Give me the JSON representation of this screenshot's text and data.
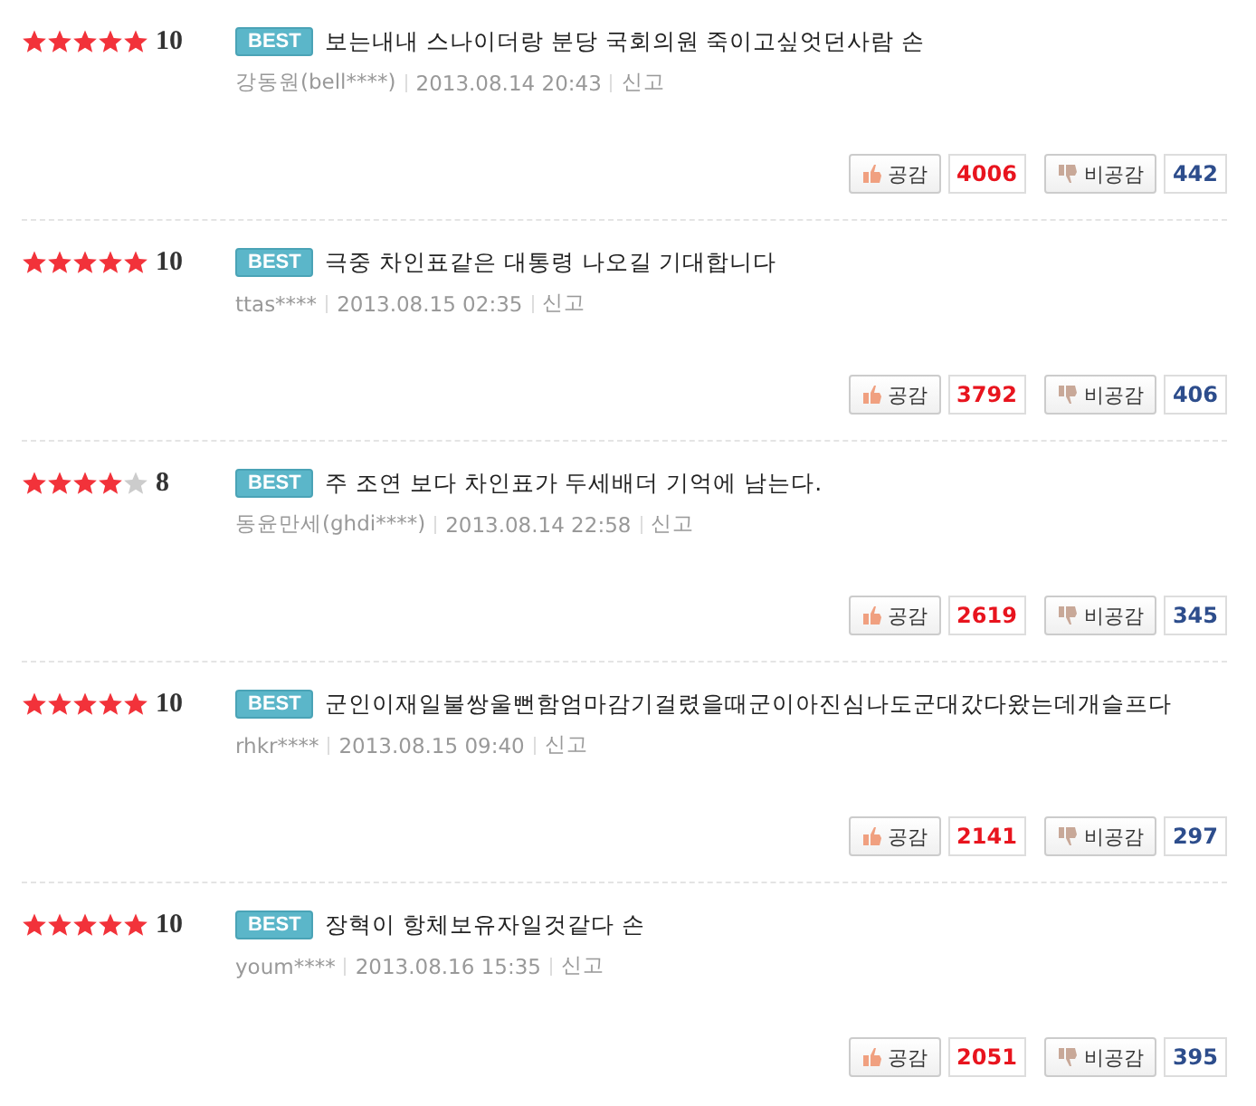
{
  "comments": [
    {
      "stars": 5,
      "score": "10",
      "badge": "BEST",
      "text": "보는내내 스나이더랑 분당 국회의원 죽이고싶엇던사람 손",
      "author": "강동원(bell****)",
      "date": "2013.08.14 20:43",
      "report": "신고",
      "like_label": "공감",
      "likes": "4006",
      "dislike_label": "비공감",
      "dislikes": "442"
    },
    {
      "stars": 5,
      "score": "10",
      "badge": "BEST",
      "text": "극중 차인표같은 대통령 나오길 기대합니다",
      "author": "ttas****",
      "date": "2013.08.15 02:35",
      "report": "신고",
      "like_label": "공감",
      "likes": "3792",
      "dislike_label": "비공감",
      "dislikes": "406"
    },
    {
      "stars": 4,
      "score": "8",
      "badge": "BEST",
      "text": "주 조연 보다 차인표가 두세배더 기억에 남는다.",
      "author": "동윤만세(ghdi****)",
      "date": "2013.08.14 22:58",
      "report": "신고",
      "like_label": "공감",
      "likes": "2619",
      "dislike_label": "비공감",
      "dislikes": "345"
    },
    {
      "stars": 5,
      "score": "10",
      "badge": "BEST",
      "text": "군인이재일불쌍울뻔함엄마감기걸렸을때군이아진심나도군대갔다왔는데개슬프다",
      "author": "rhkr****",
      "date": "2013.08.15 09:40",
      "report": "신고",
      "like_label": "공감",
      "likes": "2141",
      "dislike_label": "비공감",
      "dislikes": "297"
    },
    {
      "stars": 5,
      "score": "10",
      "badge": "BEST",
      "text": "장혁이 항체보유자일것같다 손",
      "author": "youm****",
      "date": "2013.08.16 15:35",
      "report": "신고",
      "like_label": "공감",
      "likes": "2051",
      "dislike_label": "비공감",
      "dislikes": "395"
    }
  ]
}
